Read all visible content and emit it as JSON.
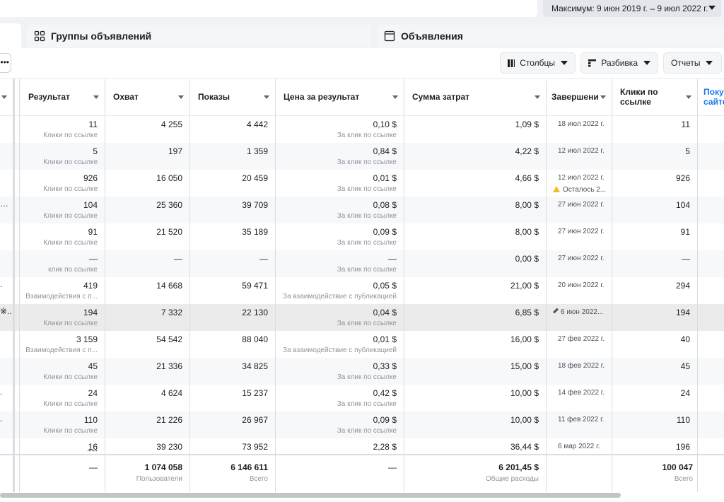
{
  "date_range": {
    "label": "Максимум: 9 июн 2019 г. – 9 июл 2022 г."
  },
  "tabs": {
    "ad_groups": "Группы объявлений",
    "ads": "Объявления"
  },
  "toolbar": {
    "more": "•••",
    "columns": "Столбцы",
    "breakdown": "Разбивка",
    "reports": "Отчеты"
  },
  "columns": [
    "Результат",
    "Охват",
    "Показы",
    "Цена за результат",
    "Сумма затрат",
    "Завершени",
    "Клики по ссылке",
    "Поку сайте"
  ],
  "rows": [
    {
      "lead": "",
      "result": "11",
      "result_type": "Клики по ссылке",
      "reach": "4 255",
      "impressions": "4 442",
      "cpr": "0,10 $",
      "cpr_type": "За клик по ссылке",
      "spend": "1,09 $",
      "end": "18 июл 2022 г.",
      "end_note": "",
      "link_clicks": "11"
    },
    {
      "lead": "",
      "result": "5",
      "result_type": "Клики по ссылке",
      "reach": "197",
      "impressions": "1 359",
      "cpr": "0,84 $",
      "cpr_type": "За клик по ссылке",
      "spend": "4,22 $",
      "end": "12 июл 2022 г.",
      "end_note": "",
      "link_clicks": "5"
    },
    {
      "lead": "",
      "result": "926",
      "result_type": "Клики по ссылке",
      "reach": "16 050",
      "impressions": "20 459",
      "cpr": "0,01 $",
      "cpr_type": "За клик по ссылке",
      "spend": "4,66 $",
      "end": "12 июл 2022 г.",
      "end_note": "Осталось 2...",
      "link_clicks": "926"
    },
    {
      "lead": "…",
      "result": "104",
      "result_type": "Клики по ссылке",
      "reach": "25 360",
      "impressions": "39 709",
      "cpr": "0,08 $",
      "cpr_type": "За клик по ссылке",
      "spend": "8,00 $",
      "end": "27 июн 2022 г.",
      "end_note": "",
      "link_clicks": "104"
    },
    {
      "lead": "",
      "result": "91",
      "result_type": "Клики по ссылке",
      "reach": "21 520",
      "impressions": "35 189",
      "cpr": "0,09 $",
      "cpr_type": "За клик по ссылке",
      "spend": "8,00 $",
      "end": "27 июн 2022 г.",
      "end_note": "",
      "link_clicks": "91"
    },
    {
      "lead": "",
      "result": "—",
      "result_type": "клик по ссылке",
      "reach": "—",
      "impressions": "—",
      "cpr": "—",
      "cpr_type": "За клик по ссылке",
      "spend": "0,00 $",
      "end": "27 июн 2022 г.",
      "end_note": "",
      "link_clicks": "—"
    },
    {
      "lead": ".",
      "result": "419",
      "result_type": "Взаимодействия с п...",
      "reach": "14 668",
      "impressions": "59 471",
      "cpr": "0,05 $",
      "cpr_type": "За взаимодействие с публикацией",
      "spend": "21,00 $",
      "end": "20 июн 2022 г.",
      "end_note": "",
      "link_clicks": "294"
    },
    {
      "lead": "※..",
      "result": "194",
      "result_type": "Клики по ссылке",
      "reach": "7 332",
      "impressions": "22 130",
      "cpr": "0,04 $",
      "cpr_type": "За клик по ссылке",
      "spend": "6,85 $",
      "end": "6 июн 2022...",
      "end_note": "",
      "link_clicks": "194"
    },
    {
      "lead": "",
      "result": "3 159",
      "result_type": "Взаимодействия с п...",
      "reach": "54 542",
      "impressions": "88 040",
      "cpr": "0,01 $",
      "cpr_type": "За взаимодействие с публикацией",
      "spend": "16,00 $",
      "end": "27 фев 2022 г.",
      "end_note": "",
      "link_clicks": "40"
    },
    {
      "lead": "",
      "result": "45",
      "result_type": "Клики по ссылке",
      "reach": "21 336",
      "impressions": "34 825",
      "cpr": "0,33 $",
      "cpr_type": "За клик по ссылке",
      "spend": "15,00 $",
      "end": "18 фев 2022 г.",
      "end_note": "",
      "link_clicks": "45"
    },
    {
      "lead": ".",
      "result": "24",
      "result_type": "Клики по ссылке",
      "reach": "4 624",
      "impressions": "15 237",
      "cpr": "0,42 $",
      "cpr_type": "За клик по ссылке",
      "spend": "10,00 $",
      "end": "14 фев 2022 г.",
      "end_note": "",
      "link_clicks": "24"
    },
    {
      "lead": ".",
      "result": "110",
      "result_type": "Клики по ссылке",
      "reach": "21 226",
      "impressions": "26 967",
      "cpr": "0,09 $",
      "cpr_type": "За клик по ссылке",
      "spend": "10,00 $",
      "end": "11 фев 2022 г.",
      "end_note": "",
      "link_clicks": "110"
    },
    {
      "lead": "",
      "result": "16",
      "result_type": "",
      "reach": "39 230",
      "impressions": "73 952",
      "cpr": "2,28 $",
      "cpr_type": "",
      "spend": "36,44 $",
      "end": "6 мар 2022 г.",
      "end_note": "",
      "link_clicks": "196"
    }
  ],
  "totals": {
    "result": "—",
    "reach": "1 074 058",
    "reach_label": "Пользователи",
    "impressions": "6 146 611",
    "impressions_label": "Всего",
    "cpr": "—",
    "spend": "6 201,45 $",
    "spend_label": "Общие расходы",
    "link_clicks": "100 047",
    "link_clicks_label": "Всего"
  }
}
